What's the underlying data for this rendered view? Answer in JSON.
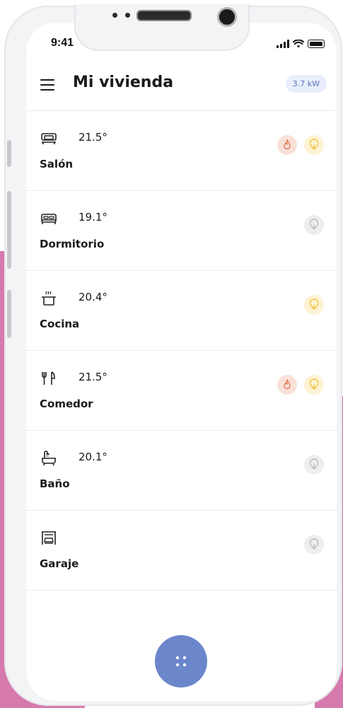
{
  "status_bar": {
    "time": "9:41"
  },
  "header": {
    "title": "Mi vivienda",
    "power_badge": "3.7 kW"
  },
  "rooms": [
    {
      "name": "Salón",
      "temperature": "21.5°",
      "icon": "sofa-icon",
      "heating": true,
      "light": true
    },
    {
      "name": "Dormitorio",
      "temperature": "19.1°",
      "icon": "bed-icon",
      "heating": false,
      "light": false
    },
    {
      "name": "Cocina",
      "temperature": "20.4°",
      "icon": "pot-icon",
      "heating": false,
      "light": true
    },
    {
      "name": "Comedor",
      "temperature": "21.5°",
      "icon": "fork-knife-icon",
      "heating": true,
      "light": true
    },
    {
      "name": "Baño",
      "temperature": "20.1°",
      "icon": "bathtub-icon",
      "heating": false,
      "light": false
    },
    {
      "name": "Garaje",
      "temperature": "",
      "icon": "garage-icon",
      "heating": false,
      "light": false
    }
  ],
  "colors": {
    "accent": "#6b86cb",
    "heat_icon": "#e07b52",
    "light_on_icon": "#f0c23a",
    "light_off_icon": "#b9b9b9",
    "background_pink": "#d67aae"
  },
  "fab": {
    "icon": "grid-dots-icon"
  }
}
